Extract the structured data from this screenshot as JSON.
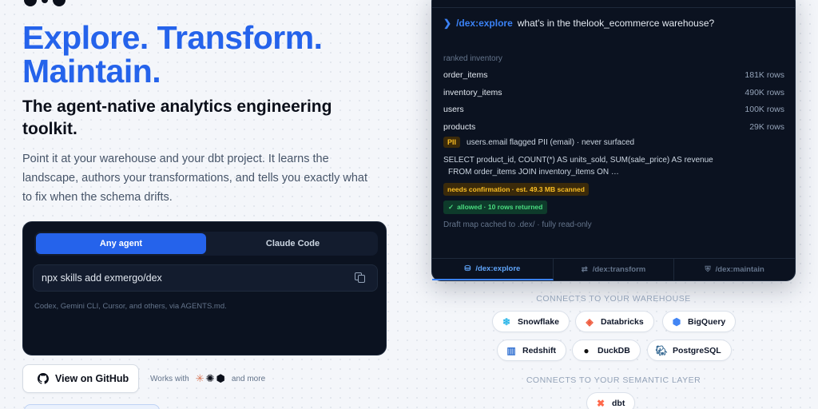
{
  "hero": {
    "headline_line1": "Explore. Transform.",
    "headline_line2": "Maintain.",
    "subhead": "The agent-native analytics engineering toolkit.",
    "description": "Point it at your warehouse and your dbt project. It learns the landscape, authors your transformations, and tells you exactly what to fix when the schema drifts."
  },
  "install": {
    "tabs": [
      "Any agent",
      "Claude Code"
    ],
    "command": "npx skills add exmergo/dex",
    "note": "Codex, Gemini CLI, Cursor, and others, via AGENTS.md."
  },
  "cta": {
    "github_label": "View on GitHub",
    "works_with": "Works with",
    "and_more": "and more"
  },
  "terminal": {
    "prompt_command": "/dex:explore",
    "prompt_text": "what's in the thelook_ecommerce warehouse?",
    "inventory_label": "ranked inventory",
    "inventory": [
      {
        "name": "order_items",
        "count": "181K rows"
      },
      {
        "name": "inventory_items",
        "count": "490K rows"
      },
      {
        "name": "users",
        "count": "100K rows"
      },
      {
        "name": "products",
        "count": "29K rows"
      }
    ],
    "pii_badge": "PII",
    "pii_text": "users.email flagged PII (email) · never surfaced",
    "sql_line1": "SELECT product_id, COUNT(*) AS units_sold, SUM(sale_price) AS revenue",
    "sql_line2": "FROM order_items JOIN inventory_items ON …",
    "confirm_badge": "needs confirmation · est. 49.3 MB scanned",
    "allowed_badge": "allowed · 10 rows returned",
    "cache_line": "Draft map cached to .dex/ · fully read-only",
    "tabs": [
      "/dex:explore",
      "/dex:transform",
      "/dex:maintain"
    ]
  },
  "warehouses": {
    "label": "CONNECTS TO YOUR WAREHOUSE",
    "items": [
      {
        "name": "Snowflake",
        "icon": "snowflake-icon",
        "color": "#29b5e8"
      },
      {
        "name": "Databricks",
        "icon": "databricks-icon",
        "color": "#ef5a3c"
      },
      {
        "name": "BigQuery",
        "icon": "bigquery-icon",
        "color": "#4285f4"
      },
      {
        "name": "Redshift",
        "icon": "redshift-icon",
        "color": "#2f6fd1"
      },
      {
        "name": "DuckDB",
        "icon": "duckdb-icon",
        "color": "#fff000"
      },
      {
        "name": "PostgreSQL",
        "icon": "postgresql-icon",
        "color": "#336791"
      }
    ]
  },
  "semantic": {
    "label": "CONNECTS TO YOUR SEMANTIC LAYER",
    "items": [
      {
        "name": "dbt",
        "icon": "dbt-icon",
        "color": "#ff694b"
      }
    ]
  }
}
